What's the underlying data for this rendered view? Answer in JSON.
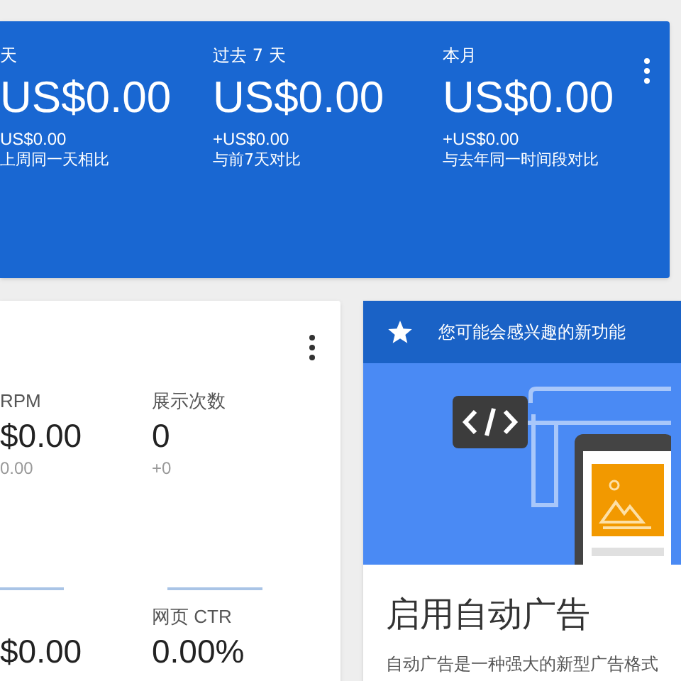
{
  "earnings_card": {
    "periods": [
      {
        "label": "天",
        "amount": "US$0.00",
        "change": "US$0.00",
        "comparison": "上周同一天相比"
      },
      {
        "label": "过去 7 天",
        "amount": "US$0.00",
        "change": "+US$0.00",
        "comparison": "与前7天对比"
      },
      {
        "label": "本月",
        "amount": "US$0.00",
        "change": "+US$0.00",
        "comparison": "与去年同一时间段对比"
      }
    ]
  },
  "metrics_card": {
    "rows": [
      {
        "metrics": [
          {
            "label": "RPM",
            "value": "$0.00",
            "change": "0.00"
          },
          {
            "label": "展示次数",
            "value": "0",
            "change": "+0"
          }
        ]
      },
      {
        "metrics": [
          {
            "value": "$0.00"
          },
          {
            "label": "网页 CTR",
            "value": "0.00%"
          }
        ]
      }
    ]
  },
  "feature_card": {
    "header": "您可能会感兴趣的新功能",
    "title": "启用自动广告",
    "body": "自动广告是一种强大的新型广告格式"
  }
}
